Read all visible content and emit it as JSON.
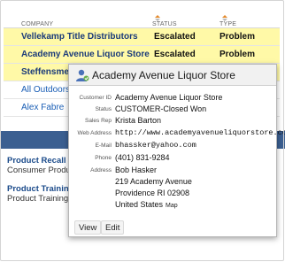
{
  "table": {
    "headers": {
      "company": "COMPANY",
      "status": "STATUS",
      "type": "TYPE"
    },
    "rows": [
      {
        "company": "Vellekamp Title Distributors",
        "status": "Escalated",
        "type": "Problem"
      },
      {
        "company": "Academy Avenue Liquor Store",
        "status": "Escalated",
        "type": "Problem"
      },
      {
        "company": "Steffensmeie",
        "status": "",
        "type": ""
      },
      {
        "company": "All Outdoors",
        "status": "",
        "type": ""
      },
      {
        "company": "Alex Fabre",
        "status": "",
        "type": ""
      }
    ]
  },
  "lower": {
    "items": [
      {
        "title": "Product Recall",
        "sub": "Consumer Produ"
      },
      {
        "title": "Product Training",
        "sub": "Product Training"
      }
    ]
  },
  "popup": {
    "title": "Academy Avenue Liquor Store",
    "labels": {
      "customer_id": "Customer ID",
      "status": "Status",
      "sales_rep": "Sales Rep",
      "web": "Web Address",
      "email": "E-Mail",
      "phone": "Phone",
      "address": "Address"
    },
    "customer_id": "Academy Avenue Liquor Store",
    "status": "CUSTOMER-Closed Won",
    "sales_rep": "Krista Barton",
    "web": "http://www.academyavenueliquorstore.com",
    "email": "bhassker@yahoo.com",
    "phone": "(401) 831-9284",
    "address": {
      "name": "Bob Hasker",
      "street": "219 Academy Avenue",
      "city": "Providence RI 02908",
      "country": "United States",
      "map": "Map"
    },
    "buttons": {
      "view": "View",
      "edit": "Edit"
    }
  },
  "colors": {
    "highlight": "#fff9a7",
    "lower_bar": "#3b5f91",
    "link": "#1a5eb5"
  },
  "icons": [
    "sort-icon",
    "person-icon"
  ]
}
